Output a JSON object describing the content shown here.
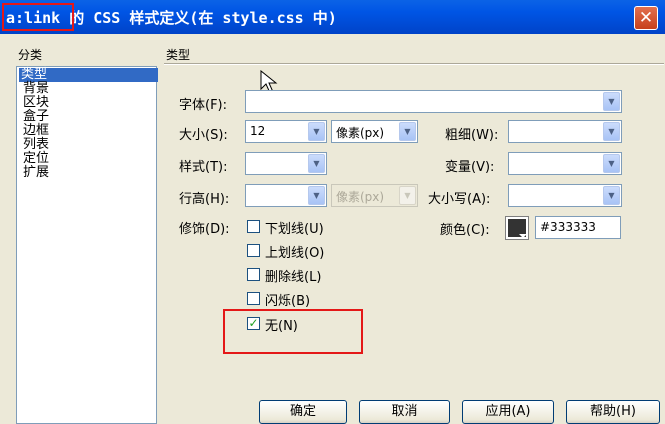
{
  "window": {
    "title": "a:link 的 CSS 样式定义(在 style.css 中)",
    "close_icon": "close-icon"
  },
  "categories": {
    "heading": "分类",
    "items": [
      "类型",
      "背景",
      "区块",
      "盒子",
      "边框",
      "列表",
      "定位",
      "扩展"
    ],
    "selected": "类型"
  },
  "section": {
    "title": "类型"
  },
  "fields": {
    "font_label": "字体(F):",
    "font_value": "",
    "size_label": "大小(S):",
    "size_value": "12",
    "size_unit": "像素(px)",
    "weight_label": "粗细(W):",
    "weight_value": "",
    "style_label": "样式(T):",
    "style_value": "",
    "variant_label": "变量(V):",
    "variant_value": "",
    "lineheight_label": "行高(H):",
    "lineheight_value": "",
    "lineheight_unit": "像素(px)",
    "case_label": "大小写(A):",
    "case_value": "",
    "decoration_label": "修饰(D):",
    "color_label": "颜色(C):",
    "color_value": "#333333"
  },
  "decorations": [
    {
      "label": "下划线(U)",
      "checked": false
    },
    {
      "label": "上划线(O)",
      "checked": false
    },
    {
      "label": "删除线(L)",
      "checked": false
    },
    {
      "label": "闪烁(B)",
      "checked": false
    },
    {
      "label": "无(N)",
      "checked": true
    }
  ],
  "buttons": {
    "ok": "确定",
    "cancel": "取消",
    "apply": "应用(A)",
    "help": "帮助(H)"
  },
  "colors": {
    "title_bar": "#0055e5",
    "selection": "#316ac5",
    "annotation_red": "#e41818",
    "text_color_swatch": "#333333"
  }
}
